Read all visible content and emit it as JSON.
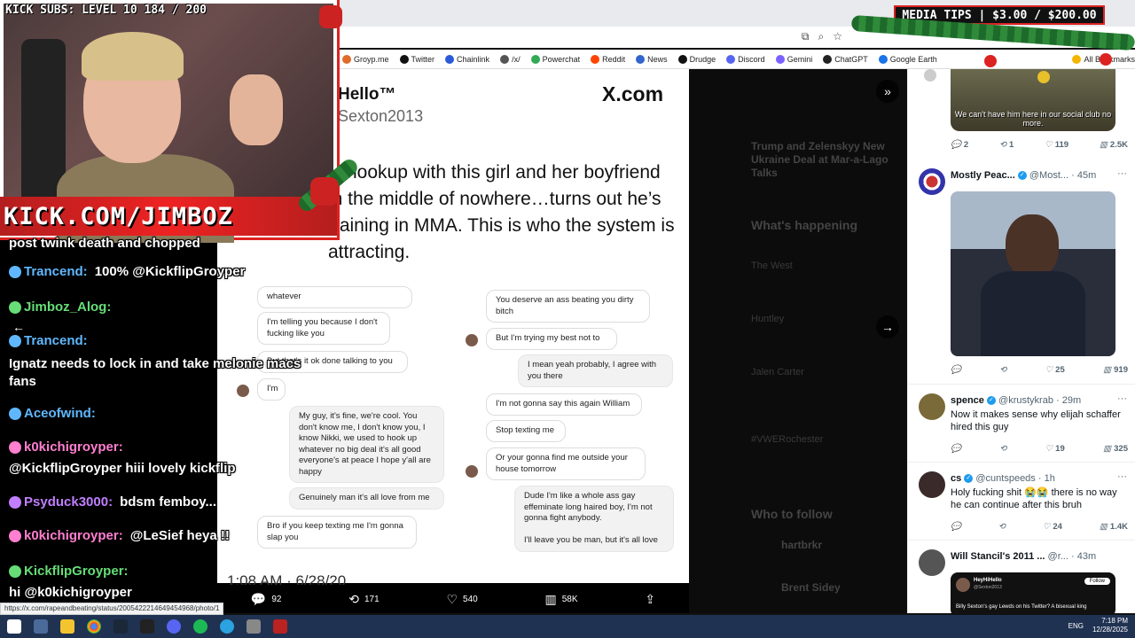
{
  "stream": {
    "subs_label": "KICK SUBS: LEVEL 10 184 / 200",
    "media_label": "MEDIA TIPS | $3.00 / $200.00",
    "banner_text": "KICK.COM/JIMBOZ"
  },
  "bookmarks": [
    {
      "label": "Groyp.me",
      "color": "#e06b2a"
    },
    {
      "label": "Twitter",
      "color": "#111111"
    },
    {
      "label": "Chainlink",
      "color": "#2a5ada"
    },
    {
      "label": "/x/",
      "color": "#555555"
    },
    {
      "label": "Powerchat",
      "color": "#33aa55"
    },
    {
      "label": "Reddit",
      "color": "#ff4500"
    },
    {
      "label": "News",
      "color": "#3366cc"
    },
    {
      "label": "Drudge",
      "color": "#111111"
    },
    {
      "label": "Discord",
      "color": "#5865f2"
    },
    {
      "label": "Gemini",
      "color": "#7b61ff"
    },
    {
      "label": "ChatGPT",
      "color": "#222222"
    },
    {
      "label": "Google Earth",
      "color": "#1a73e8"
    },
    {
      "label": "All Bookmarks",
      "color": "#f4b400"
    }
  ],
  "tweet_image": {
    "name": "Hello™",
    "handle": "Sexton2013",
    "brand": "X.com",
    "text": "…hookup with this girl and her boyfriend in the middle of nowhere…turns out he’s training in MMA. This is who the system is attracting.",
    "timestamp": "1:08 AM · 6/28/20",
    "left_messages": [
      {
        "text": "whatever",
        "side": "them"
      },
      {
        "text": "I'm telling you because I don't fucking like you",
        "side": "them"
      },
      {
        "text": "But that's it ok done talking to you",
        "side": "them"
      },
      {
        "text": "I'm",
        "side": "them"
      },
      {
        "text": "My guy, it's fine, we're cool. You don't know me, I don't know you, I know Nikki, we used to hook up whatever no big deal it's all good everyone's at peace I hope y'all are happy",
        "side": "me"
      },
      {
        "text": "Genuinely man it's all love from me",
        "side": "me"
      },
      {
        "text": "Bro if you keep texting me I'm gonna slap you",
        "side": "them"
      }
    ],
    "right_messages": [
      {
        "text": "You deserve an ass beating you dirty bitch",
        "side": "them"
      },
      {
        "text": "But I'm trying my best not to",
        "side": "them"
      },
      {
        "text": "I mean yeah probably, I agree with you there",
        "side": "me"
      },
      {
        "text": "I'm not gonna say this again William",
        "side": "them"
      },
      {
        "text": "Stop texting me",
        "side": "them"
      },
      {
        "text": "Or your gonna find me outside your house tomorrow",
        "side": "them"
      },
      {
        "text": "Dude I'm like a whole ass gay effeminate long haired boy, I'm not gonna fight anybody.\n\nI'll leave you be man, but it's all love",
        "side": "me"
      }
    ]
  },
  "modal_actions": {
    "replies": "92",
    "reposts": "171",
    "likes": "540",
    "views": "58K"
  },
  "chat": [
    {
      "user": "",
      "msg": "post twink death and chopped",
      "color": "#ffffff"
    },
    {
      "user": "Trancend:",
      "msg": "100% @KickflipGroyper",
      "color": "#5fb8ff"
    },
    {
      "user": "Jimboz_Alog:",
      "msg": "",
      "color": "#66dd77"
    },
    {
      "user": "Trancend:",
      "msg": "",
      "color": "#5fb8ff"
    },
    {
      "user": "",
      "msg": "Ignatz needs to lock in and take melonie macs",
      "color": "#ffffff"
    },
    {
      "user": "",
      "msg": "fans",
      "color": "#ffffff"
    },
    {
      "user": "Aceofwind:",
      "msg": "",
      "color": "#5fb8ff"
    },
    {
      "user": "k0kichigroyper:",
      "msg": "",
      "color": "#ff7fd0"
    },
    {
      "user": "",
      "msg": "@KickflipGroyper hiii lovely kickflip",
      "color": "#ffffff"
    },
    {
      "user": "Psyduck3000:",
      "msg": "bdsm femboy...",
      "color": "#c07fff"
    },
    {
      "user": "k0kichigroyper:",
      "msg": "@LeSief heya !!",
      "color": "#ff7fd0"
    },
    {
      "user": "KickflipGroyper:",
      "msg": "",
      "color": "#66dd77"
    },
    {
      "user": "",
      "msg": "hi @k0kichigroyper",
      "color": "#ffffff"
    }
  ],
  "feed": {
    "top_video_caption": "We can't have him here in our social club no more.",
    "top_stats": {
      "replies": "2",
      "reposts": "1",
      "likes": "119",
      "views": "2.5K"
    },
    "tweets": [
      {
        "name": "Mostly Peac...",
        "handle": "@Most...",
        "time": "45m",
        "text": "",
        "replies": "",
        "reposts": "",
        "likes": "25",
        "views": "919"
      },
      {
        "name": "spence",
        "handle": "@krustykrab",
        "time": "29m",
        "text": "Now it makes sense why elijah schaffer hired this guy",
        "replies": "",
        "reposts": "",
        "likes": "19",
        "views": "325"
      },
      {
        "name": "cs",
        "handle": "@cuntspeeds",
        "time": "1h",
        "text": "Holy fucking shit 😭😭 there is no way he can continue after this bruh",
        "replies": "",
        "reposts": "",
        "likes": "24",
        "views": "1.4K"
      },
      {
        "name": "Will Stancil's 2011 ...",
        "handle": "@r...",
        "time": "43m",
        "text": "",
        "replies": "",
        "reposts": "",
        "likes": "",
        "views": ""
      }
    ],
    "embed_caption": "Billy Sexton's gay Lewds on his Twitter? A bisexual king",
    "embed_follow": "Follow",
    "embed_name": "HeyHiHello",
    "embed_handle": "@Sexton2013"
  },
  "background_sidebar": {
    "trend_title": "Trump and Zelenskyy New Ukraine Deal at Mar-a-Lago Talks",
    "whats_happening": "What's happening",
    "trends": [
      "The West",
      "Huntley",
      "Jalen Carter",
      "#VWERochester"
    ],
    "who_to_follow": "Who to follow",
    "follow_names": [
      "hartbrkr",
      "Brent Sidey"
    ]
  },
  "status_url": "https://x.com/rapeandbeating/status/2005422214649454968/photo/1",
  "tray": {
    "lang": "ENG",
    "time": "7:18 PM",
    "date": "12/28/2025"
  }
}
